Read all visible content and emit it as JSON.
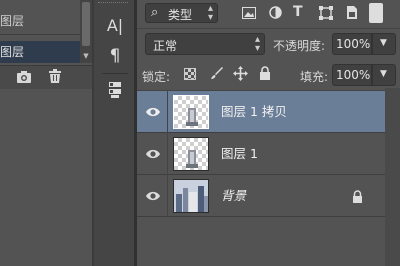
{
  "history_panel": {
    "items": [
      {
        "label": "图层",
        "selected": false
      },
      {
        "label": "图层",
        "selected": true
      }
    ],
    "toolbar_icons": [
      "camera-icon",
      "trash-icon"
    ]
  },
  "tool_strip": {
    "tools": [
      {
        "label": "A|",
        "icon": "character-icon"
      },
      {
        "label": "¶",
        "icon": "paragraph-icon"
      },
      {
        "icon": "layer-comps-icon"
      }
    ]
  },
  "layers_panel": {
    "filter": {
      "search_glyph": "⌕",
      "kind_label": "类型"
    },
    "filter_icons": [
      "pixel-filter-icon",
      "adjustment-filter-icon",
      "type-filter-icon",
      "shape-filter-icon",
      "smart-object-filter-icon"
    ],
    "blend_mode": "正常",
    "opacity_label": "不透明度:",
    "opacity_value": "100%",
    "lock_label": "锁定:",
    "lock_icons": [
      "lock-transparent-icon",
      "lock-image-icon",
      "lock-position-icon",
      "lock-all-icon"
    ],
    "fill_label": "填充:",
    "fill_value": "100%",
    "layers": [
      {
        "name": "图层 1 拷贝",
        "selected": true,
        "italic": false,
        "thumb": "transparent-building"
      },
      {
        "name": "图层 1",
        "selected": false,
        "italic": false,
        "thumb": "transparent-building"
      },
      {
        "name": "背景",
        "selected": false,
        "italic": true,
        "thumb": "photo",
        "locked": true
      }
    ],
    "colors": {
      "selected_row": "#6b7e98",
      "panel_bg": "#535353",
      "field_bg": "#404040"
    }
  }
}
